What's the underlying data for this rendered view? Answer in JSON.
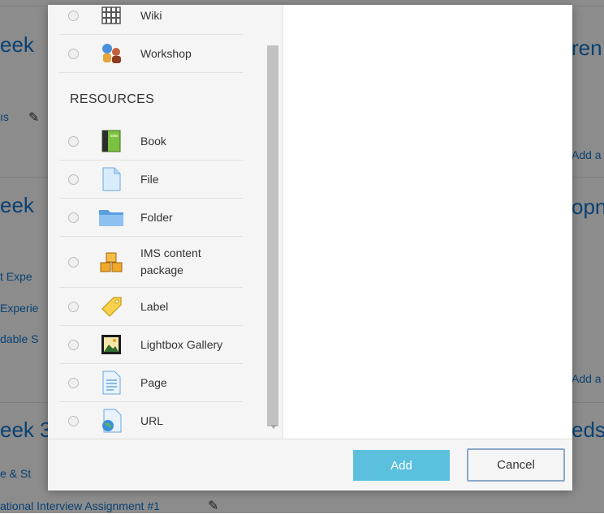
{
  "background": {
    "headings": [
      "eek",
      "eek",
      "eek 3",
      "ren",
      "opn",
      "eds"
    ],
    "links": [
      "ıs",
      "t Expe",
      "Experie",
      "dable S",
      "e & St",
      "Add a",
      "Add a"
    ],
    "bottom_link": "ational Interview Assignment #1"
  },
  "activity_list": {
    "top_items": [
      {
        "label": "Wiki",
        "icon": "wiki-icon"
      },
      {
        "label": "Workshop",
        "icon": "workshop-icon"
      }
    ],
    "section_title": "RESOURCES",
    "resources": [
      {
        "label": "Book",
        "icon": "book-icon"
      },
      {
        "label": "File",
        "icon": "file-icon"
      },
      {
        "label": "Folder",
        "icon": "folder-icon"
      },
      {
        "label": "IMS content package",
        "icon": "ims-package-icon"
      },
      {
        "label": "Label",
        "icon": "label-tag-icon"
      },
      {
        "label": "Lightbox Gallery",
        "icon": "image-gallery-icon"
      },
      {
        "label": "Page",
        "icon": "page-icon"
      },
      {
        "label": "URL",
        "icon": "url-globe-icon"
      }
    ]
  },
  "footer": {
    "add_label": "Add",
    "cancel_label": "Cancel"
  },
  "colors": {
    "add_button": "#5bc0de",
    "cancel_border": "#8aa8c9",
    "link_blue": "#1177d1"
  }
}
